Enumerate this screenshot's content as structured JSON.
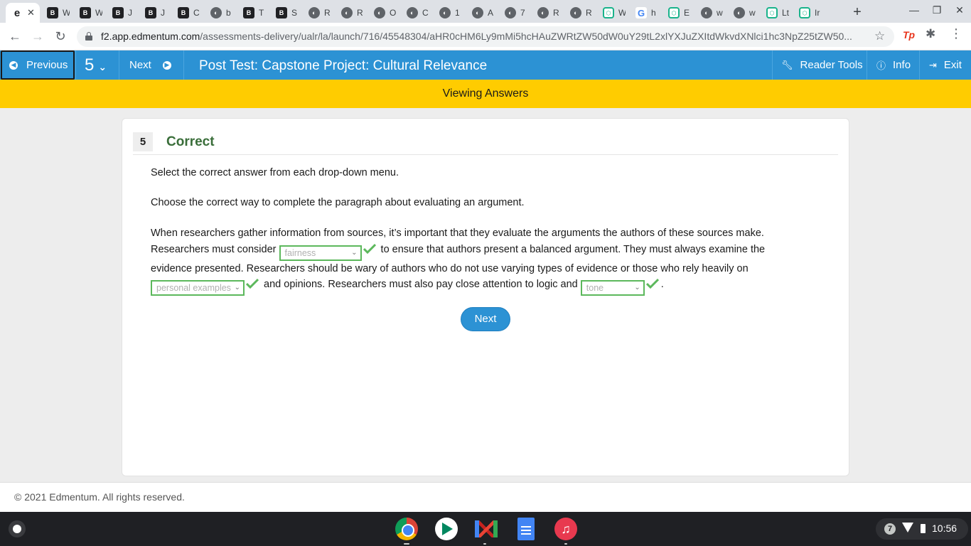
{
  "browser": {
    "tabs": [
      {
        "favicon": "edmentum-icon",
        "label": "e",
        "active": true
      },
      {
        "favicon": "b-icon",
        "label": "W"
      },
      {
        "favicon": "b-icon",
        "label": "W"
      },
      {
        "favicon": "b-icon",
        "label": "J"
      },
      {
        "favicon": "b-icon",
        "label": "J"
      },
      {
        "favicon": "b-icon",
        "label": "C"
      },
      {
        "favicon": "globe-icon",
        "label": "b"
      },
      {
        "favicon": "b-icon",
        "label": "T"
      },
      {
        "favicon": "b-icon",
        "label": "S"
      },
      {
        "favicon": "globe-icon",
        "label": "R"
      },
      {
        "favicon": "globe-icon",
        "label": "R"
      },
      {
        "favicon": "globe-icon",
        "label": "O"
      },
      {
        "favicon": "globe-icon",
        "label": "C"
      },
      {
        "favicon": "globe-icon",
        "label": "1"
      },
      {
        "favicon": "globe-icon",
        "label": "A"
      },
      {
        "favicon": "globe-icon",
        "label": "7"
      },
      {
        "favicon": "globe-icon",
        "label": "R"
      },
      {
        "favicon": "globe-icon",
        "label": "R"
      },
      {
        "favicon": "hex-icon",
        "label": "W"
      },
      {
        "favicon": "google-icon",
        "label": "h"
      },
      {
        "favicon": "hex-icon",
        "label": "E"
      },
      {
        "favicon": "globe-icon",
        "label": "w"
      },
      {
        "favicon": "globe-icon",
        "label": "w"
      },
      {
        "favicon": "hex-icon",
        "label": "Lt"
      },
      {
        "favicon": "hex-icon",
        "label": "Ir"
      }
    ],
    "close_glyph": "✕",
    "new_tab_glyph": "+",
    "url_domain": "f2.app.edmentum.com",
    "url_path": "/assessments-delivery/ualr/la/launch/716/45548304/aHR0cHM6Ly9mMi5hcHAuZWRtZW50dW0uY29tL2xlYXJuZXItdWkvdXNlci1hc3NpZ25tZW50..."
  },
  "header": {
    "previous_label": "Previous",
    "question_number": "5",
    "next_label": "Next",
    "title": "Post Test: Capstone Project: Cultural Relevance",
    "reader_tools_label": "Reader Tools",
    "info_label": "Info",
    "exit_label": "Exit"
  },
  "banner": {
    "text": "Viewing Answers"
  },
  "question": {
    "number": "5",
    "status": "Correct",
    "instruction_1": "Select the correct answer from each drop-down menu.",
    "instruction_2": "Choose the correct way to complete the paragraph about evaluating an argument.",
    "paragraph": {
      "text_1": "When researchers gather information from sources, it’s important that they evaluate the arguments the authors of these sources make. Researchers must consider ",
      "dropdown_1": "fairness",
      "text_2": " to ensure that authors present a balanced argument. They must always examine the evidence presented. Researchers should be wary of authors who do not use varying types of evidence or those who rely heavily on ",
      "dropdown_2": "personal examples",
      "text_3": " and opinions. Researchers must also pay close attention to logic and ",
      "dropdown_3": "tone",
      "text_4": "."
    },
    "next_label": "Next",
    "status_color": "#3a6e3a",
    "check_color": "#5cb85c"
  },
  "footer": {
    "copyright": "© 2021 Edmentum. All rights reserved."
  },
  "shelf": {
    "time": "10:56",
    "notification_count": "7"
  }
}
